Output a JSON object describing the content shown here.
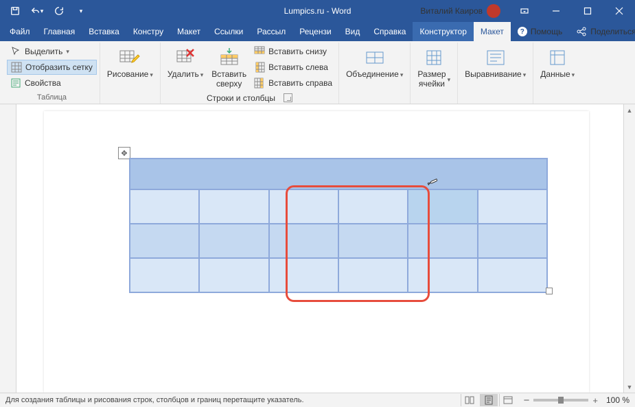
{
  "titlebar": {
    "title": "Lumpics.ru - Word",
    "user": "Виталий Каиров"
  },
  "tabs": {
    "file": "Файл",
    "home": "Главная",
    "insert": "Вставка",
    "design": "Констру",
    "layout": "Макет",
    "references": "Ссылки",
    "mailings": "Рассыл",
    "review": "Рецензи",
    "view": "Вид",
    "help": "Справка",
    "ctx_design": "Конструктор",
    "ctx_layout": "Макет",
    "helpq": "Помощь",
    "share": "Поделиться"
  },
  "ribbon": {
    "table_group": "Таблица",
    "rowscols_group": "Строки и столбцы",
    "select": "Выделить",
    "view_gridlines": "Отобразить сетку",
    "properties": "Свойства",
    "draw": "Рисование",
    "delete": "Удалить",
    "insert_above": "Вставить\nсверху",
    "insert_below": "Вставить снизу",
    "insert_left": "Вставить слева",
    "insert_right": "Вставить справа",
    "merge": "Объединение",
    "cellsize": "Размер\nячейки",
    "alignment": "Выравнивание",
    "data": "Данные"
  },
  "status": {
    "msg": "Для создания таблицы и рисования строк, столбцов и границ перетащите указатель.",
    "zoom": "100 %"
  }
}
